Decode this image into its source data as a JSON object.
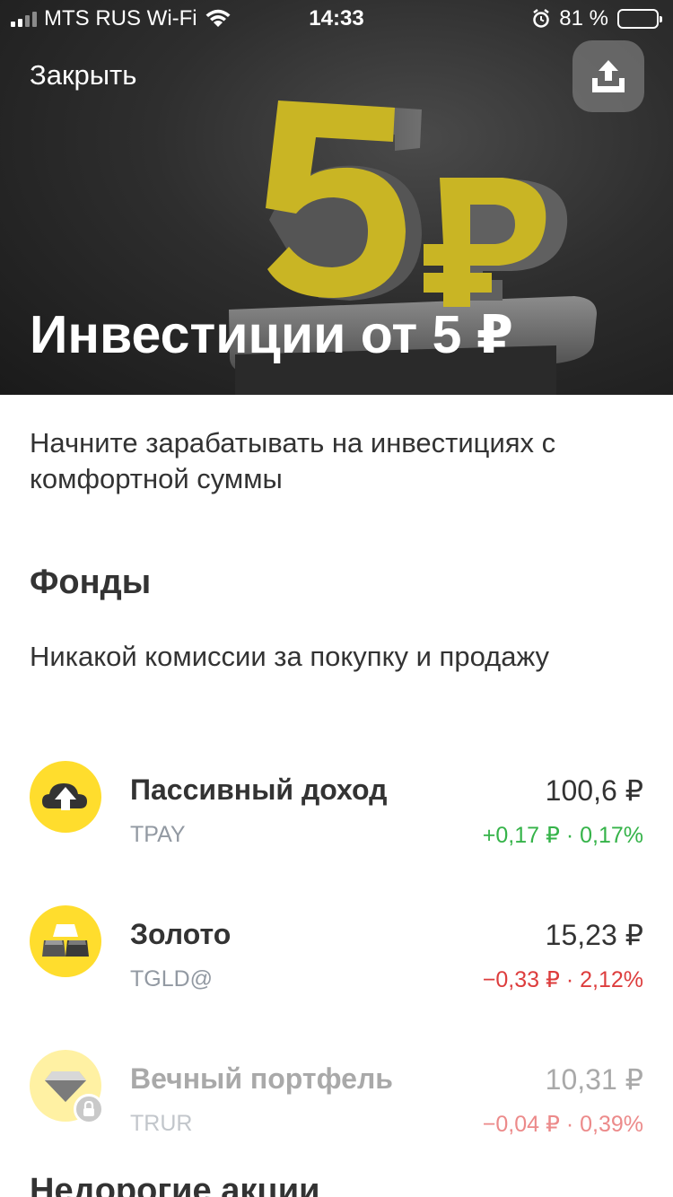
{
  "status_bar": {
    "carrier": "MTS RUS Wi-Fi",
    "time": "14:33",
    "battery_percent": "81 %",
    "battery_level": 0.81
  },
  "header": {
    "close_label": "Закрыть",
    "share_icon": "share-upload-icon",
    "title": "Инвестиции от 5 ₽",
    "art_text_number": "5",
    "art_text_currency": "₽"
  },
  "intro": {
    "subtitle": "Начните зарабатывать на инвестициях с комфортной суммы"
  },
  "funds_section": {
    "title": "Фонды",
    "description": "Никакой комиссии за покупку и продажу",
    "items": [
      {
        "name": "Пассивный доход",
        "ticker": "TPAY",
        "price": "100,6 ₽",
        "change": "+0,17 ₽ · 0,17%",
        "change_color": "#35b349",
        "icon": "cloud-upload-icon",
        "locked": false
      },
      {
        "name": "Золото",
        "ticker": "TGLD@",
        "price": "15,23 ₽",
        "change": "−0,33 ₽ · 2,12%",
        "change_color": "#dd3d3d",
        "icon": "gold-bars-icon",
        "locked": false
      },
      {
        "name": "Вечный портфель",
        "ticker": "TRUR",
        "price": "10,31 ₽",
        "change": "−0,04 ₽ · 0,39%",
        "change_color": "#ec8a8a",
        "icon": "diamond-icon",
        "locked": true
      }
    ]
  },
  "next_section": {
    "title": "Недорогие акции"
  },
  "colors": {
    "accent_yellow": "#ffdd2d",
    "positive": "#35b349",
    "negative": "#dd3d3d"
  }
}
